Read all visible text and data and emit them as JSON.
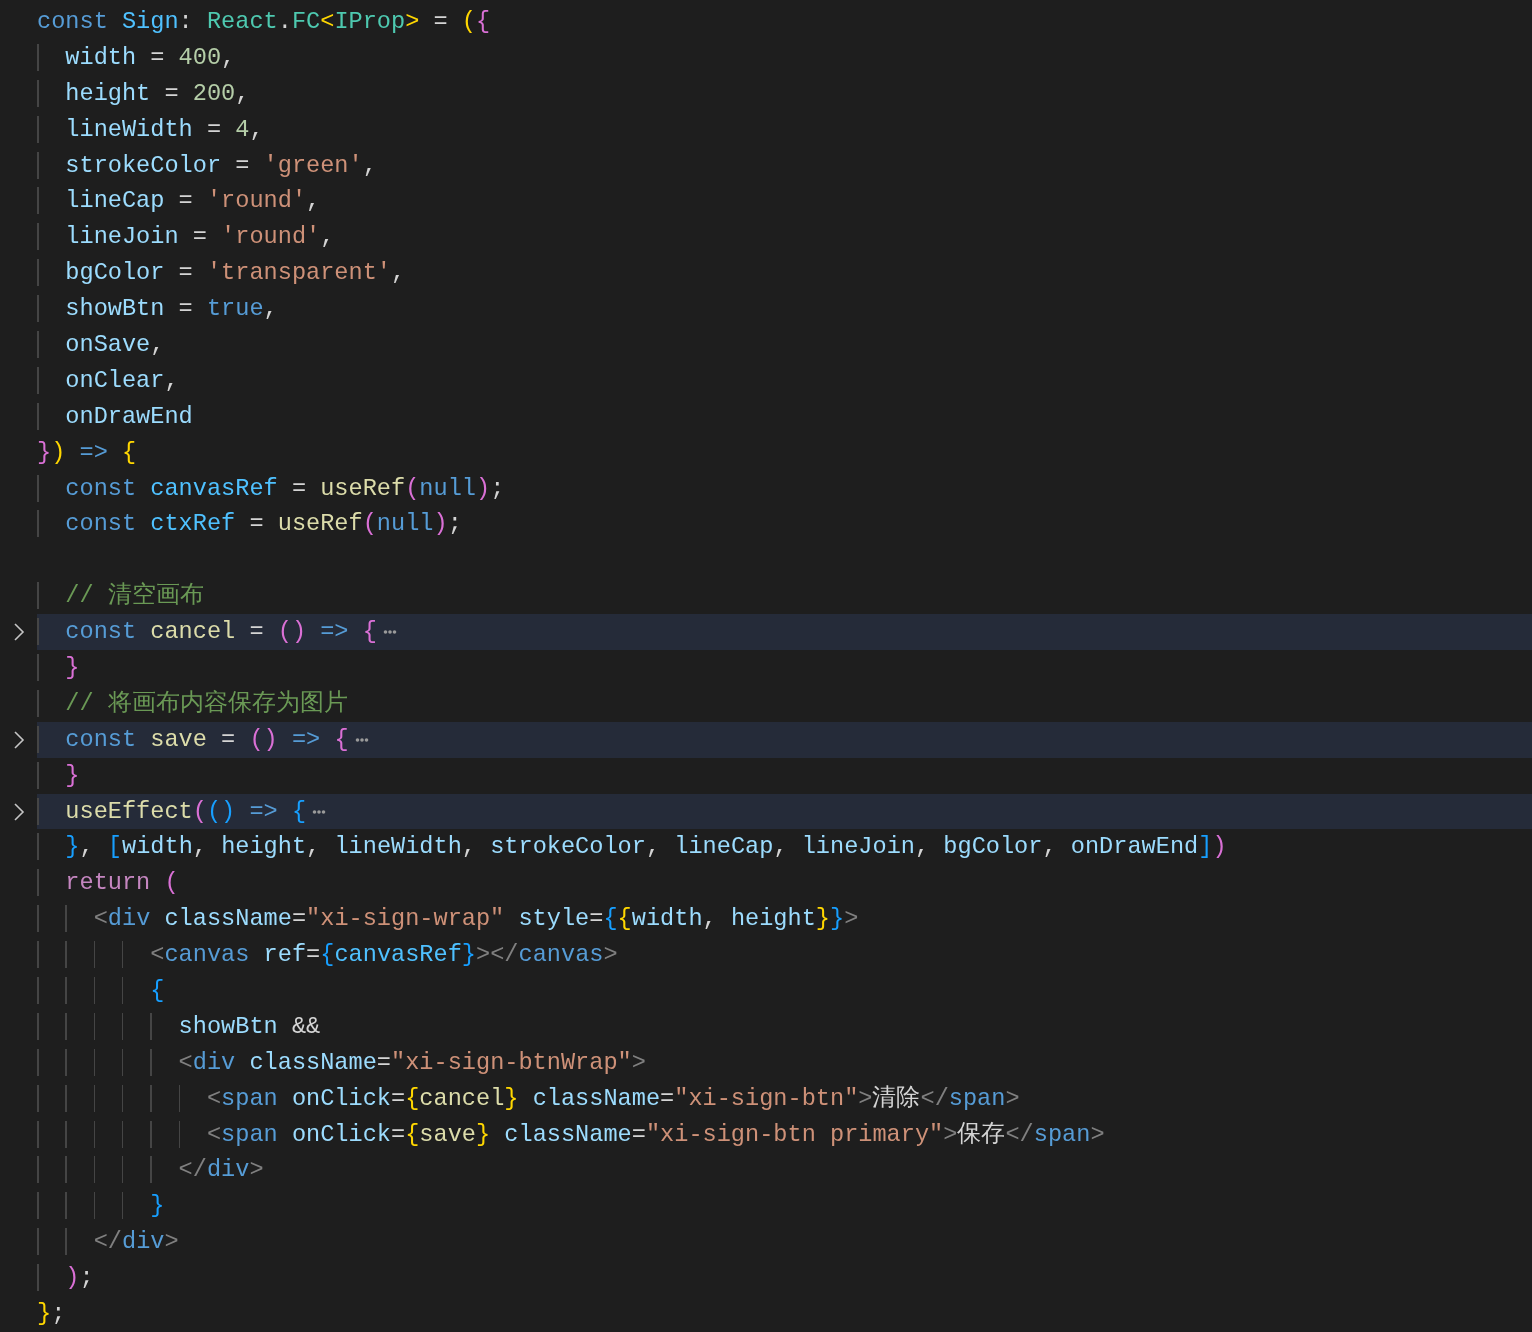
{
  "editor": {
    "lines": [
      {
        "folded": false,
        "tokens": [
          {
            "text": "const ",
            "kind": "keyword"
          },
          {
            "text": "Sign",
            "kind": "constant"
          },
          {
            "text": ": ",
            "kind": "plain"
          },
          {
            "text": "React",
            "kind": "type"
          },
          {
            "text": ".",
            "kind": "plain"
          },
          {
            "text": "FC",
            "kind": "type"
          },
          {
            "text": "<",
            "kind": "bracket1"
          },
          {
            "text": "IProp",
            "kind": "type"
          },
          {
            "text": ">",
            "kind": "bracket1"
          },
          {
            "text": " = ",
            "kind": "plain"
          },
          {
            "text": "(",
            "kind": "bracket1"
          },
          {
            "text": "{",
            "kind": "bracket2"
          }
        ]
      },
      {
        "folded": false,
        "tokens": [
          {
            "text": "  width",
            "kind": "variable"
          },
          {
            "text": " = ",
            "kind": "plain"
          },
          {
            "text": "400",
            "kind": "number"
          },
          {
            "text": ",",
            "kind": "plain"
          }
        ]
      },
      {
        "folded": false,
        "tokens": [
          {
            "text": "  height",
            "kind": "variable"
          },
          {
            "text": " = ",
            "kind": "plain"
          },
          {
            "text": "200",
            "kind": "number"
          },
          {
            "text": ",",
            "kind": "plain"
          }
        ]
      },
      {
        "folded": false,
        "tokens": [
          {
            "text": "  lineWidth",
            "kind": "variable"
          },
          {
            "text": " = ",
            "kind": "plain"
          },
          {
            "text": "4",
            "kind": "number"
          },
          {
            "text": ",",
            "kind": "plain"
          }
        ]
      },
      {
        "folded": false,
        "tokens": [
          {
            "text": "  strokeColor",
            "kind": "variable"
          },
          {
            "text": " = ",
            "kind": "plain"
          },
          {
            "text": "'green'",
            "kind": "string"
          },
          {
            "text": ",",
            "kind": "plain"
          }
        ]
      },
      {
        "folded": false,
        "tokens": [
          {
            "text": "  lineCap",
            "kind": "variable"
          },
          {
            "text": " = ",
            "kind": "plain"
          },
          {
            "text": "'round'",
            "kind": "string"
          },
          {
            "text": ",",
            "kind": "plain"
          }
        ]
      },
      {
        "folded": false,
        "tokens": [
          {
            "text": "  lineJoin",
            "kind": "variable"
          },
          {
            "text": " = ",
            "kind": "plain"
          },
          {
            "text": "'round'",
            "kind": "string"
          },
          {
            "text": ",",
            "kind": "plain"
          }
        ]
      },
      {
        "folded": false,
        "tokens": [
          {
            "text": "  bgColor",
            "kind": "variable"
          },
          {
            "text": " = ",
            "kind": "plain"
          },
          {
            "text": "'transparent'",
            "kind": "string"
          },
          {
            "text": ",",
            "kind": "plain"
          }
        ]
      },
      {
        "folded": false,
        "tokens": [
          {
            "text": "  showBtn",
            "kind": "variable"
          },
          {
            "text": " = ",
            "kind": "plain"
          },
          {
            "text": "true",
            "kind": "keyword"
          },
          {
            "text": ",",
            "kind": "plain"
          }
        ]
      },
      {
        "folded": false,
        "tokens": [
          {
            "text": "  onSave",
            "kind": "variable"
          },
          {
            "text": ",",
            "kind": "plain"
          }
        ]
      },
      {
        "folded": false,
        "tokens": [
          {
            "text": "  onClear",
            "kind": "variable"
          },
          {
            "text": ",",
            "kind": "plain"
          }
        ]
      },
      {
        "folded": false,
        "tokens": [
          {
            "text": "  onDrawEnd",
            "kind": "variable"
          }
        ]
      },
      {
        "folded": false,
        "tokens": [
          {
            "text": "}",
            "kind": "bracket2"
          },
          {
            "text": ") ",
            "kind": "bracket1"
          },
          {
            "text": "=> ",
            "kind": "keyword"
          },
          {
            "text": "{",
            "kind": "bracket1"
          }
        ]
      },
      {
        "folded": false,
        "tokens": [
          {
            "text": "  const ",
            "kind": "keyword"
          },
          {
            "text": "canvasRef",
            "kind": "constant"
          },
          {
            "text": " = ",
            "kind": "plain"
          },
          {
            "text": "useRef",
            "kind": "function"
          },
          {
            "text": "(",
            "kind": "bracket2"
          },
          {
            "text": "null",
            "kind": "keyword"
          },
          {
            "text": ")",
            "kind": "bracket2"
          },
          {
            "text": ";",
            "kind": "plain"
          }
        ]
      },
      {
        "folded": false,
        "tokens": [
          {
            "text": "  const ",
            "kind": "keyword"
          },
          {
            "text": "ctxRef",
            "kind": "constant"
          },
          {
            "text": " = ",
            "kind": "plain"
          },
          {
            "text": "useRef",
            "kind": "function"
          },
          {
            "text": "(",
            "kind": "bracket2"
          },
          {
            "text": "null",
            "kind": "keyword"
          },
          {
            "text": ")",
            "kind": "bracket2"
          },
          {
            "text": ";",
            "kind": "plain"
          }
        ]
      },
      {
        "folded": false
      },
      {
        "folded": false,
        "tokens": [
          {
            "text": "  // 清空画布",
            "kind": "comment"
          }
        ]
      },
      {
        "folded": true,
        "tokens": [
          {
            "text": "  const ",
            "kind": "keyword"
          },
          {
            "text": "cancel",
            "kind": "function"
          },
          {
            "text": " = ",
            "kind": "plain"
          },
          {
            "text": "() ",
            "kind": "bracket2"
          },
          {
            "text": "=> ",
            "kind": "keyword"
          },
          {
            "text": "{",
            "kind": "bracket2"
          }
        ]
      },
      {
        "folded": false,
        "tokens": [
          {
            "text": "  }",
            "kind": "bracket2"
          }
        ]
      },
      {
        "folded": false,
        "tokens": [
          {
            "text": "  // 将画布内容保存为图片",
            "kind": "comment"
          }
        ]
      },
      {
        "folded": true,
        "tokens": [
          {
            "text": "  const ",
            "kind": "keyword"
          },
          {
            "text": "save",
            "kind": "function"
          },
          {
            "text": " = ",
            "kind": "plain"
          },
          {
            "text": "() ",
            "kind": "bracket2"
          },
          {
            "text": "=> ",
            "kind": "keyword"
          },
          {
            "text": "{",
            "kind": "bracket2"
          }
        ]
      },
      {
        "folded": false,
        "tokens": [
          {
            "text": "  }",
            "kind": "bracket2"
          }
        ]
      },
      {
        "folded": true,
        "tokens": [
          {
            "text": "  useEffect",
            "kind": "function"
          },
          {
            "text": "(",
            "kind": "bracket2"
          },
          {
            "text": "() ",
            "kind": "bracket3"
          },
          {
            "text": "=> ",
            "kind": "keyword"
          },
          {
            "text": "{",
            "kind": "bracket3"
          }
        ]
      },
      {
        "folded": false,
        "tokens": [
          {
            "text": "  }",
            "kind": "bracket3"
          },
          {
            "text": ", ",
            "kind": "plain"
          },
          {
            "text": "[",
            "kind": "bracket3"
          },
          {
            "text": "width",
            "kind": "variable"
          },
          {
            "text": ", ",
            "kind": "plain"
          },
          {
            "text": "height",
            "kind": "variable"
          },
          {
            "text": ", ",
            "kind": "plain"
          },
          {
            "text": "lineWidth",
            "kind": "variable"
          },
          {
            "text": ", ",
            "kind": "plain"
          },
          {
            "text": "strokeColor",
            "kind": "variable"
          },
          {
            "text": ", ",
            "kind": "plain"
          },
          {
            "text": "lineCap",
            "kind": "variable"
          },
          {
            "text": ", ",
            "kind": "plain"
          },
          {
            "text": "lineJoin",
            "kind": "variable"
          },
          {
            "text": ", ",
            "kind": "plain"
          },
          {
            "text": "bgColor",
            "kind": "variable"
          },
          {
            "text": ", ",
            "kind": "plain"
          },
          {
            "text": "onDrawEnd",
            "kind": "variable"
          },
          {
            "text": "]",
            "kind": "bracket3"
          },
          {
            "text": ")",
            "kind": "bracket2"
          }
        ]
      },
      {
        "folded": false,
        "tokens": [
          {
            "text": "  return ",
            "kind": "control"
          },
          {
            "text": "(",
            "kind": "bracket2"
          }
        ]
      },
      {
        "folded": false,
        "tokens": [
          {
            "text": "    <",
            "kind": "punctuation"
          },
          {
            "text": "div ",
            "kind": "tag"
          },
          {
            "text": "className",
            "kind": "variable"
          },
          {
            "text": "=",
            "kind": "plain"
          },
          {
            "text": "\"xi-sign-wrap\" ",
            "kind": "string"
          },
          {
            "text": "style",
            "kind": "variable"
          },
          {
            "text": "=",
            "kind": "plain"
          },
          {
            "text": "{",
            "kind": "bracket3"
          },
          {
            "text": "{",
            "kind": "bracket1"
          },
          {
            "text": "width",
            "kind": "variable"
          },
          {
            "text": ", ",
            "kind": "plain"
          },
          {
            "text": "height",
            "kind": "variable"
          },
          {
            "text": "}",
            "kind": "bracket1"
          },
          {
            "text": "}",
            "kind": "bracket3"
          },
          {
            "text": ">",
            "kind": "punctuation"
          }
        ]
      },
      {
        "folded": false,
        "tokens": [
          {
            "text": "        <",
            "kind": "punctuation"
          },
          {
            "text": "canvas ",
            "kind": "tag"
          },
          {
            "text": "ref",
            "kind": "variable"
          },
          {
            "text": "=",
            "kind": "plain"
          },
          {
            "text": "{",
            "kind": "bracket3"
          },
          {
            "text": "canvasRef",
            "kind": "constant"
          },
          {
            "text": "}",
            "kind": "bracket3"
          },
          {
            "text": "></",
            "kind": "punctuation"
          },
          {
            "text": "canvas",
            "kind": "tag"
          },
          {
            "text": ">",
            "kind": "punctuation"
          }
        ]
      },
      {
        "folded": false,
        "tokens": [
          {
            "text": "        {",
            "kind": "bracket3"
          }
        ]
      },
      {
        "folded": false,
        "tokens": [
          {
            "text": "          showBtn",
            "kind": "variable"
          },
          {
            "text": " &&",
            "kind": "plain"
          }
        ]
      },
      {
        "folded": false,
        "tokens": [
          {
            "text": "          <",
            "kind": "punctuation"
          },
          {
            "text": "div ",
            "kind": "tag"
          },
          {
            "text": "className",
            "kind": "variable"
          },
          {
            "text": "=",
            "kind": "plain"
          },
          {
            "text": "\"xi-sign-btnWrap\"",
            "kind": "string"
          },
          {
            "text": ">",
            "kind": "punctuation"
          }
        ]
      },
      {
        "folded": false,
        "tokens": [
          {
            "text": "            <",
            "kind": "punctuation"
          },
          {
            "text": "span ",
            "kind": "tag"
          },
          {
            "text": "onClick",
            "kind": "variable"
          },
          {
            "text": "=",
            "kind": "plain"
          },
          {
            "text": "{",
            "kind": "bracket1"
          },
          {
            "text": "cancel",
            "kind": "function"
          },
          {
            "text": "} ",
            "kind": "bracket1"
          },
          {
            "text": "className",
            "kind": "variable"
          },
          {
            "text": "=",
            "kind": "plain"
          },
          {
            "text": "\"xi-sign-btn\"",
            "kind": "string"
          },
          {
            "text": ">",
            "kind": "punctuation"
          },
          {
            "text": "清除",
            "kind": "plain"
          },
          {
            "text": "</",
            "kind": "punctuation"
          },
          {
            "text": "span",
            "kind": "tag"
          },
          {
            "text": ">",
            "kind": "punctuation"
          }
        ]
      },
      {
        "folded": false,
        "tokens": [
          {
            "text": "            <",
            "kind": "punctuation"
          },
          {
            "text": "span ",
            "kind": "tag"
          },
          {
            "text": "onClick",
            "kind": "variable"
          },
          {
            "text": "=",
            "kind": "plain"
          },
          {
            "text": "{",
            "kind": "bracket1"
          },
          {
            "text": "save",
            "kind": "function"
          },
          {
            "text": "} ",
            "kind": "bracket1"
          },
          {
            "text": "className",
            "kind": "variable"
          },
          {
            "text": "=",
            "kind": "plain"
          },
          {
            "text": "\"xi-sign-btn primary\"",
            "kind": "string"
          },
          {
            "text": ">",
            "kind": "punctuation"
          },
          {
            "text": "保存",
            "kind": "plain"
          },
          {
            "text": "</",
            "kind": "punctuation"
          },
          {
            "text": "span",
            "kind": "tag"
          },
          {
            "text": ">",
            "kind": "punctuation"
          }
        ]
      },
      {
        "folded": false,
        "tokens": [
          {
            "text": "          </",
            "kind": "punctuation"
          },
          {
            "text": "div",
            "kind": "tag"
          },
          {
            "text": ">",
            "kind": "punctuation"
          }
        ]
      },
      {
        "folded": false,
        "tokens": [
          {
            "text": "        }",
            "kind": "bracket3"
          }
        ]
      },
      {
        "folded": false,
        "tokens": [
          {
            "text": "    </",
            "kind": "punctuation"
          },
          {
            "text": "div",
            "kind": "tag"
          },
          {
            "text": ">",
            "kind": "punctuation"
          }
        ]
      },
      {
        "folded": false,
        "tokens": [
          {
            "text": "  )",
            "kind": "bracket2"
          },
          {
            "text": ";",
            "kind": "plain"
          }
        ]
      },
      {
        "folded": false,
        "tokens": [
          {
            "text": "}",
            "kind": "bracket1"
          },
          {
            "text": ";",
            "kind": "plain"
          }
        ]
      }
    ]
  }
}
